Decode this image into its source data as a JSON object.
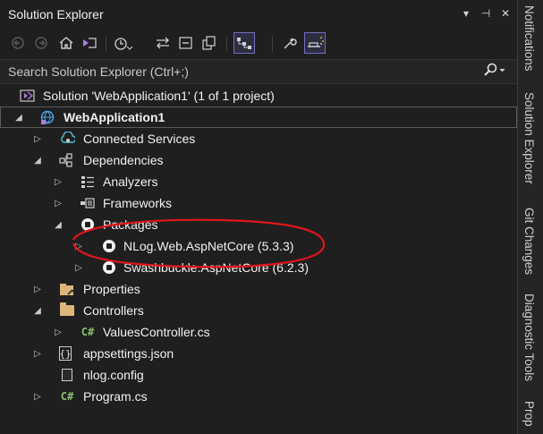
{
  "window": {
    "title": "Solution Explorer",
    "controls": [
      "▾",
      "⊣",
      "✕"
    ]
  },
  "search": {
    "placeholder": "Search Solution Explorer (Ctrl+;)"
  },
  "tree": {
    "solution": "Solution 'WebApplication1' (1 of 1 project)",
    "project": "WebApplication1",
    "connected_services": "Connected Services",
    "dependencies": "Dependencies",
    "analyzers": "Analyzers",
    "frameworks": "Frameworks",
    "packages": "Packages",
    "pkg_nlog": "NLog.Web.AspNetCore (5.3.3)",
    "pkg_swashbuckle": "Swashbuckle.AspNetCore (6.2.3)",
    "properties": "Properties",
    "controllers": "Controllers",
    "values_controller": "ValuesController.cs",
    "appsettings": "appsettings.json",
    "nlog_config": "nlog.config",
    "program": "Program.cs",
    "cs_badge": "C#",
    "json_badge": "{}"
  },
  "side_tabs": [
    "Notifications",
    "Solution Explorer",
    "Git Changes",
    "Diagnostic Tools",
    "Prop"
  ],
  "colors": {
    "background": "#1f1f1f",
    "annotation": "#e0161b",
    "folder": "#dcb67a",
    "csharp": "#86c06b"
  }
}
